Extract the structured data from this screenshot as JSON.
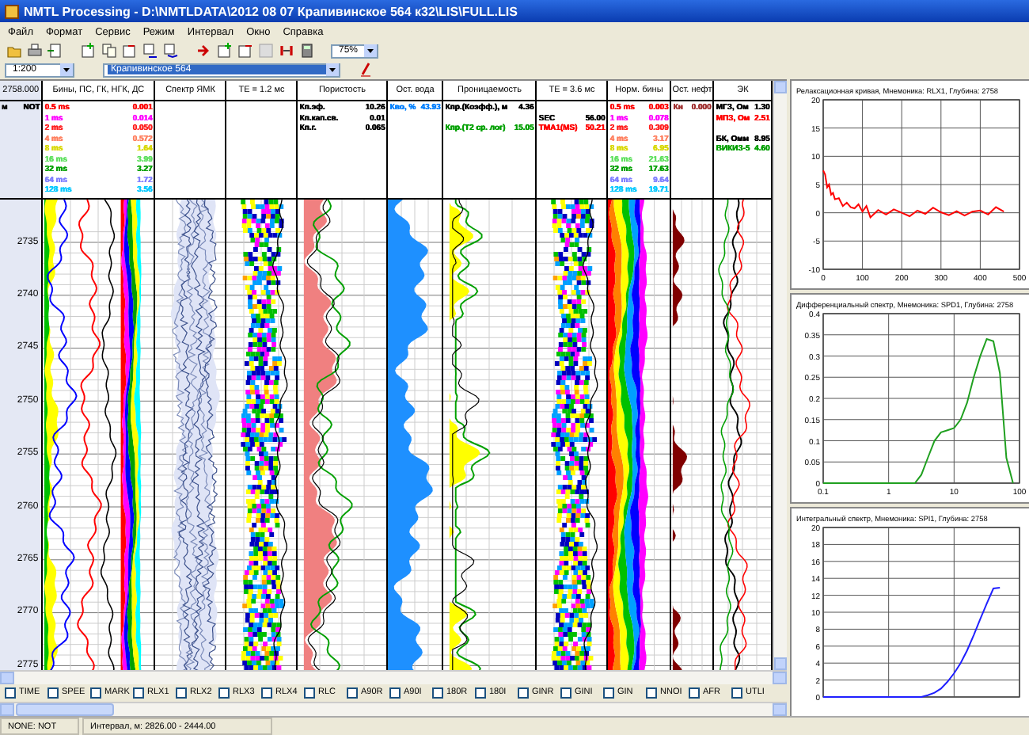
{
  "window": {
    "title": "NMTL Processing - D:\\NMTLDATA\\2012 08 07 Крапивинское 564 к32\\LIS\\FULL.LIS"
  },
  "menu": [
    "Файл",
    "Формат",
    "Сервис",
    "Режим",
    "Интервал",
    "Окно",
    "Справка"
  ],
  "toolbar": {
    "zoom": "75%",
    "scale": "1:200",
    "well": "Крапивинское 564"
  },
  "depth": {
    "header": "2758.000",
    "unit": "м",
    "mnemonic": "NOT",
    "ticks": [
      "2735",
      "2740",
      "2745",
      "2750",
      "2755",
      "2760",
      "2765",
      "2770",
      "2775"
    ]
  },
  "tracks": [
    {
      "kind": "bins",
      "header": "Бины, ПС, ГК, НГК, ДС",
      "legend": [
        {
          "label": "0.5 ms",
          "value": "0.001",
          "color": "#ff0000"
        },
        {
          "label": "1 ms",
          "value": "0.014",
          "color": "#ff00ff"
        },
        {
          "label": "2 ms",
          "value": "0.050",
          "color": "#ff2020"
        },
        {
          "label": "4 ms",
          "value": "0.572",
          "color": "#ff8060"
        },
        {
          "label": "8 ms",
          "value": "1.64",
          "color": "#d8d800"
        },
        {
          "label": "16 ms",
          "value": "3.99",
          "color": "#60e060"
        },
        {
          "label": "32 ms",
          "value": "3.27",
          "color": "#00a000"
        },
        {
          "label": "64 ms",
          "value": "1.72",
          "color": "#8080ff"
        },
        {
          "label": "128 ms",
          "value": "3.56",
          "color": "#00c8ff"
        }
      ]
    },
    {
      "kind": "spectrum",
      "header": "Спектр ЯМК"
    },
    {
      "kind": "te",
      "header": "ТЕ = 1.2 мс"
    },
    {
      "kind": "porosity",
      "header": "Пористость",
      "legend": [
        {
          "label": "Кп.эф.",
          "value": "10.26",
          "color": "#000000"
        },
        {
          "label": "Кп.кап.св.",
          "value": "0.01",
          "color": "#000000"
        },
        {
          "label": "Кп.г.",
          "value": "0.065",
          "color": "#000000"
        }
      ]
    },
    {
      "kind": "water",
      "header": "Ост. вода",
      "legend": [
        {
          "label": "Кво, %",
          "value": "43.93",
          "color": "#0080ff"
        }
      ]
    },
    {
      "kind": "perm",
      "header": "Проницаемость",
      "legend": [
        {
          "label": "Кпр.(Коэфф.), м",
          "value": "4.36",
          "color": "#000000"
        },
        {
          "label": "Кпр.(Т2 ср. лог)",
          "value": "15.05",
          "color": "#00a000",
          "gap": true
        }
      ]
    },
    {
      "kind": "te",
      "header": "ТЕ = 3.6 мс",
      "legend": [
        {
          "label": "SEC",
          "value": "56.00",
          "color": "#000000",
          "gap": true
        },
        {
          "label": "ТМА1(MS)",
          "value": "50.21",
          "color": "#ff0000"
        }
      ]
    },
    {
      "kind": "norm",
      "header": "Норм. бины",
      "legend": [
        {
          "label": "0.5 ms",
          "value": "0.003",
          "color": "#ff0000"
        },
        {
          "label": "1 ms",
          "value": "0.078",
          "color": "#ff00ff"
        },
        {
          "label": "2 ms",
          "value": "0.309",
          "color": "#ff2020"
        },
        {
          "label": "4 ms",
          "value": "3.17",
          "color": "#ff8060"
        },
        {
          "label": "8 ms",
          "value": "6.95",
          "color": "#d8d800"
        },
        {
          "label": "16 ms",
          "value": "21.63",
          "color": "#60e060"
        },
        {
          "label": "32 ms",
          "value": "17.63",
          "color": "#00a000"
        },
        {
          "label": "64 ms",
          "value": "9.64",
          "color": "#8080ff"
        },
        {
          "label": "128 ms",
          "value": "19.71",
          "color": "#00c8ff"
        }
      ]
    },
    {
      "kind": "oil",
      "header": "Ост. нефт",
      "legend": [
        {
          "label": "Кн",
          "value": "0.000",
          "color": "#a03030"
        }
      ]
    },
    {
      "kind": "resist",
      "header": "ЭК",
      "legend": [
        {
          "label": "МГЗ, Ом",
          "value": "1.30",
          "color": "#000000"
        },
        {
          "label": "МПЗ, Ом",
          "value": "2.51",
          "color": "#ff0000"
        },
        {
          "label": "БК, Омм",
          "value": "8.95",
          "color": "#000000",
          "gap": true
        },
        {
          "label": "ВИКИЗ-5",
          "value": "4.60",
          "color": "#00a000"
        }
      ]
    }
  ],
  "charts": [
    {
      "chart_data": {
        "type": "line",
        "title": "Релаксационная кривая, Мнемоника: RLX1, Глубина: 2758",
        "xlim": [
          0,
          500
        ],
        "ylim": [
          -10,
          20
        ],
        "xticks": [
          0,
          100,
          200,
          300,
          400,
          500
        ],
        "yticks": [
          -10,
          -5,
          0,
          5,
          10,
          15,
          20
        ],
        "grid": true,
        "x": [
          0,
          5,
          10,
          15,
          20,
          25,
          30,
          40,
          50,
          60,
          70,
          80,
          90,
          100,
          110,
          120,
          140,
          160,
          180,
          200,
          220,
          240,
          260,
          280,
          300,
          320,
          340,
          360,
          380,
          400,
          420,
          440,
          460
        ],
        "series": [
          {
            "color": "#ff0000",
            "values": [
              7.5,
              6.8,
              4.5,
              5,
              3.2,
              3.5,
              2.4,
              2.6,
              1.2,
              1.8,
              1.0,
              0.8,
              1.5,
              0.2,
              1.2,
              -0.8,
              0.5,
              -0.3,
              0.6,
              0.0,
              -0.6,
              0.4,
              -0.2,
              0.9,
              0.1,
              -0.4,
              0.3,
              -0.5,
              0.2,
              0.4,
              -0.3,
              1.0,
              0.2
            ]
          }
        ]
      }
    },
    {
      "chart_data": {
        "type": "line",
        "title": "Дифференциальный спектр, Мнемоника: SPD1, Глубина: 2758",
        "ylim": [
          0,
          0.4
        ],
        "yticks": [
          0,
          0.05,
          0.1,
          0.15,
          0.2,
          0.25,
          0.3,
          0.35,
          0.4
        ],
        "grid": true,
        "categories": [
          "0.1",
          null,
          null,
          null,
          null,
          null,
          null,
          null,
          null,
          null,
          "1",
          null,
          null,
          null,
          null,
          null,
          null,
          null,
          null,
          null,
          "10",
          null,
          null,
          null,
          null,
          null,
          null,
          null,
          null,
          null,
          "100"
        ],
        "series": [
          {
            "color": "#20a020",
            "values": [
              0,
              0,
              0,
              0,
              0,
              0,
              0,
              0,
              0,
              0,
              0,
              0,
              0,
              0,
              0,
              0.02,
              0.06,
              0.1,
              0.12,
              0.125,
              0.13,
              0.15,
              0.19,
              0.25,
              0.3,
              0.34,
              0.335,
              0.26,
              0.06,
              0,
              null
            ]
          }
        ]
      }
    },
    {
      "chart_data": {
        "type": "line",
        "title": "Интегральный спектр, Мнемоника: SPI1, Глубина: 2758",
        "ylim": [
          0,
          20
        ],
        "yticks": [
          0,
          2,
          4,
          6,
          8,
          10,
          12,
          14,
          16,
          18,
          20
        ],
        "grid": true,
        "categories": [
          null,
          null,
          null,
          null,
          null,
          null,
          null,
          null,
          null,
          null,
          null,
          null,
          null,
          null,
          null,
          null,
          null,
          null,
          null,
          null,
          null,
          null,
          null,
          null,
          null,
          null,
          null,
          null,
          null,
          null,
          null
        ],
        "series": [
          {
            "color": "#2020ff",
            "values": [
              0,
              0,
              0,
              0,
              0,
              0,
              0,
              0,
              0,
              0,
              0,
              0,
              0,
              0,
              0,
              0,
              0.2,
              0.5,
              1,
              1.8,
              2.8,
              4,
              5.5,
              7.3,
              9.2,
              11,
              12.8,
              12.9,
              null,
              null,
              null
            ]
          }
        ]
      }
    }
  ],
  "checkboxes": [
    {
      "label": "TIME",
      "checked": false
    },
    {
      "label": "SPEE",
      "checked": false
    },
    {
      "label": "MARK",
      "checked": false
    },
    {
      "label": "RLX1",
      "checked": false
    },
    {
      "label": "RLX2",
      "checked": false
    },
    {
      "label": "RLX3",
      "checked": false
    },
    {
      "label": "RLX4",
      "checked": false
    },
    {
      "label": "RLC",
      "checked": false
    },
    {
      "label": "A90R",
      "checked": false
    },
    {
      "label": "A90I",
      "checked": false
    },
    {
      "label": "180R",
      "checked": false
    },
    {
      "label": "180I",
      "checked": false
    },
    {
      "label": "GINR",
      "checked": false
    },
    {
      "label": "GINI",
      "checked": false
    },
    {
      "label": "GIN",
      "checked": false
    },
    {
      "label": "NNOI",
      "checked": false
    },
    {
      "label": "AFR",
      "checked": false
    },
    {
      "label": "UTLI",
      "checked": false
    }
  ],
  "status_bar": [
    "NONE: NOT",
    "Интервал, м: 2826.00 - 2444.00"
  ]
}
